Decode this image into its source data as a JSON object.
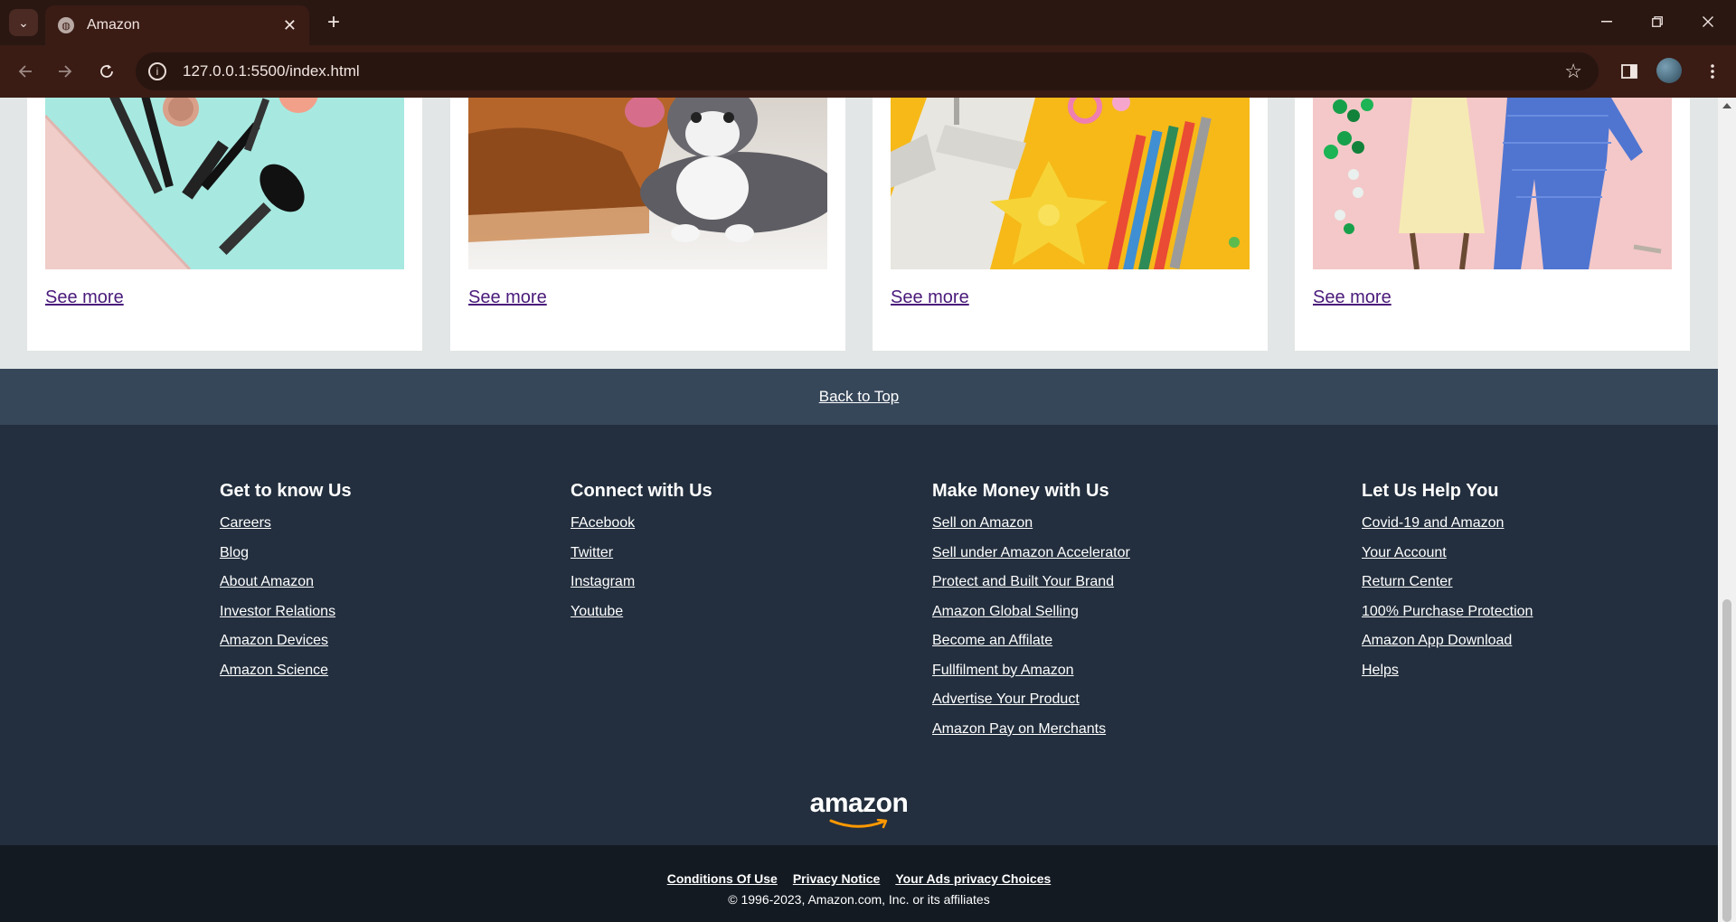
{
  "browser": {
    "tab_title": "Amazon",
    "url": "127.0.0.1:5500/index.html",
    "new_tab_glyph": "+",
    "close_glyph": "✕"
  },
  "cards": [
    {
      "link": "See more",
      "image": "makeup-pouch-photo"
    },
    {
      "link": "See more",
      "image": "dog-and-cat-photo"
    },
    {
      "link": "See more",
      "image": "toys-and-pencils-photo"
    },
    {
      "link": "See more",
      "image": "fashion-clothing-photo"
    }
  ],
  "back_to_top": "Back to Top",
  "footer": {
    "columns": [
      {
        "title": "Get to know Us",
        "links": [
          "Careers",
          "Blog",
          "About Amazon",
          "Investor Relations",
          "Amazon Devices",
          "Amazon Science"
        ]
      },
      {
        "title": "Connect with Us",
        "links": [
          "FAcebook",
          "Twitter",
          "Instagram",
          "Youtube"
        ]
      },
      {
        "title": "Make Money with Us",
        "links": [
          "Sell on Amazon",
          "Sell under Amazon Accelerator",
          "Protect and Built Your Brand",
          "Amazon Global Selling",
          "Become an Affilate",
          "Fullfilment by Amazon",
          "Advertise Your Product",
          "Amazon Pay on Merchants"
        ]
      },
      {
        "title": "Let Us Help You",
        "links": [
          "Covid-19 and Amazon",
          "Your Account",
          "Return Center",
          "100% Purchase Protection",
          "Amazon App Download",
          "Helps"
        ]
      }
    ],
    "logo": "amazon"
  },
  "bottom": {
    "links": [
      "Conditions Of Use",
      "Privacy Notice",
      "Your Ads privacy Choices"
    ],
    "copyright": "© 1996-2023, Amazon.com, Inc. or its affiliates"
  },
  "colors": {
    "back_to_top_bg": "#37475a",
    "footer_bg": "#232f3e",
    "bottom_bg": "#131a22",
    "logo_smile": "#ff9900",
    "link_visited": "#4a1a7a"
  }
}
